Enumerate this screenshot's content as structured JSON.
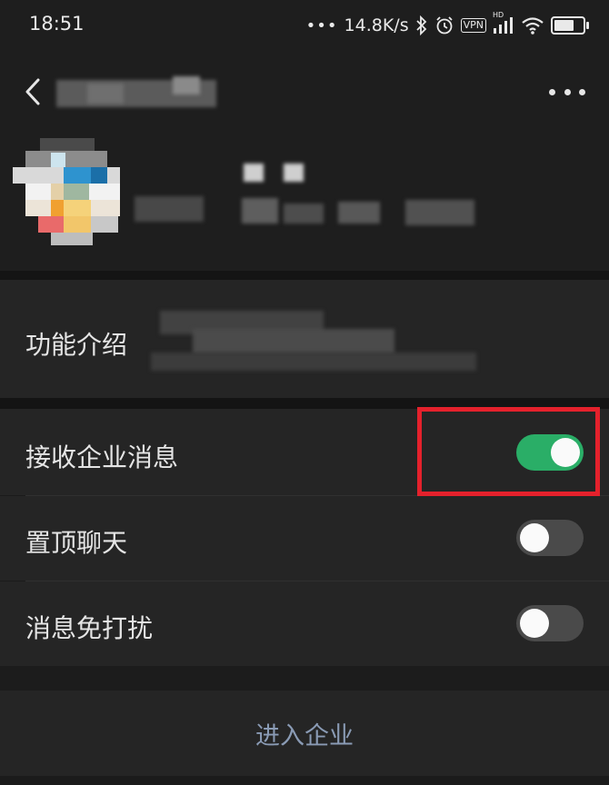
{
  "status_bar": {
    "time": "18:51",
    "network_speed": "14.8K/s",
    "vpn": "VPN",
    "hd": "HD",
    "icons": [
      "signal-dots-icon",
      "bluetooth-icon",
      "alarm-icon",
      "vpn-icon",
      "cellular-signal-icon",
      "wifi-icon",
      "battery-icon"
    ],
    "battery_level": 0.7
  },
  "nav": {
    "back_icon": "chevron-left-icon",
    "more_icon": "more-dots-icon"
  },
  "settings": {
    "intro_label": "功能介绍",
    "receive_label": "接收企业消息",
    "receive_on": true,
    "pin_label": "置顶聊天",
    "pin_on": false,
    "mute_label": "消息免打扰",
    "mute_on": false
  },
  "enter_button": "进入企业",
  "colors": {
    "toggle_on": "#2aae67",
    "toggle_off": "#4a4a4a",
    "highlight": "#e4212c",
    "link_text": "#8a9bb5"
  }
}
